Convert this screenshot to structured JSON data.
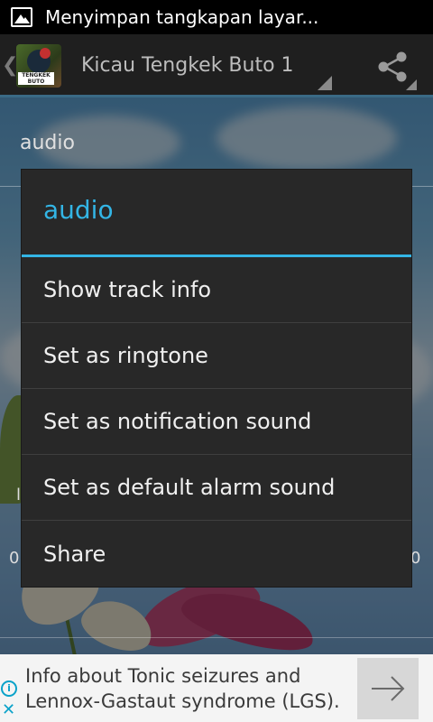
{
  "status_bar": {
    "notification_icon": "image-icon",
    "text": "Menyimpan tangkapan layar..."
  },
  "action_bar": {
    "up_icon": "chevron-left-icon",
    "app_icon": "bird-app-icon",
    "app_icon_badge": "TENGKEK BUTO",
    "title": "Kicau Tengkek Buto 1",
    "share_icon": "share-icon"
  },
  "background": {
    "section_label": "audio",
    "left_mark": "l",
    "left_digit": "0",
    "right_digit": "0"
  },
  "dialog": {
    "title": "audio",
    "items": [
      {
        "label": "Show track info"
      },
      {
        "label": "Set as ringtone"
      },
      {
        "label": "Set as notification sound"
      },
      {
        "label": "Set as default alarm sound"
      },
      {
        "label": "Share"
      }
    ]
  },
  "ad": {
    "info_icon": "info-icon",
    "close_icon": "close-icon",
    "line1": "Info about Tonic seizures and",
    "line2": "Lennox-Gastaut syndrome (LGS).",
    "arrow_icon": "arrow-right-icon"
  },
  "colors": {
    "accent": "#33b5e5",
    "dialog_bg": "#282828",
    "action_bar_bg": "#1f1f1f"
  }
}
